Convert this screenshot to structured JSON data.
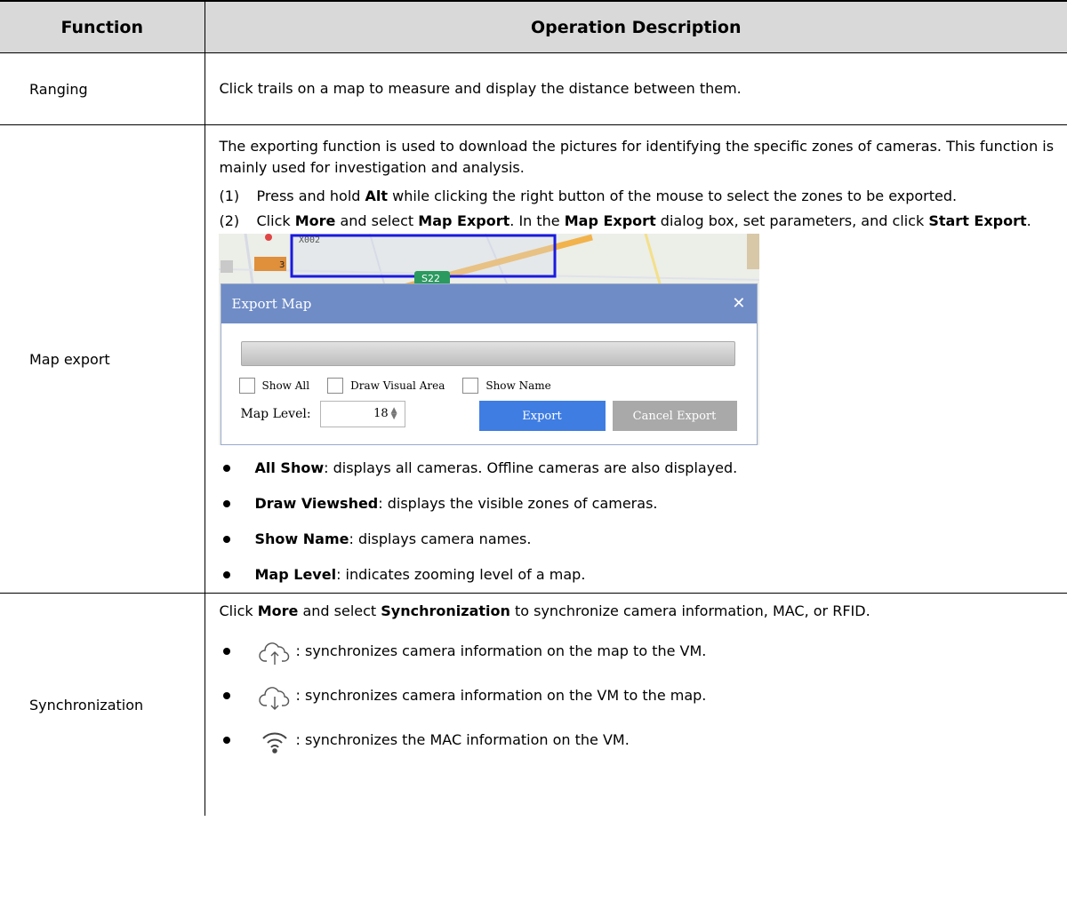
{
  "headers": {
    "function": "Function",
    "description": "Operation Description"
  },
  "rows": {
    "ranging": {
      "function": "Ranging",
      "description": "Click trails on a map to measure and display the distance between them."
    },
    "map_export": {
      "function": "Map export",
      "intro": "The exporting function is used to download the pictures for identifying the specific zones of cameras. This function is mainly used for investigation and analysis.",
      "step1": {
        "num": "(1)",
        "t1": "Press and hold ",
        "b1": "Alt",
        "t2": " while clicking the right button of the mouse to select the zones to be exported."
      },
      "step2": {
        "num": "(2)",
        "t1": "Click ",
        "b1": "More",
        "t2": " and select ",
        "b2": "Map Export",
        "t3": ". In the ",
        "b3": "Map Export",
        "t4": " dialog box, set parameters, and click ",
        "b4": "Start Export",
        "t5": "."
      },
      "screenshot": {
        "map_labels": {
          "road_code": "X002",
          "route_badge": "S22",
          "poi_number": "3"
        },
        "dialog_title": "Export Map",
        "show_all": "Show All",
        "draw_visual_area": "Draw Visual Area",
        "show_name": "Show Name",
        "map_level_label": "Map Level:",
        "map_level_value": "18",
        "export_button": "Export",
        "cancel_export_button": "Cancel Export",
        "colors": {
          "dialog_header": "#6f8cc7",
          "export_button": "#3f7de2",
          "cancel_button": "#a9a9a9",
          "selection_box": "#1a1ae0"
        }
      },
      "bullets": [
        {
          "term": "All Show",
          "text": ": displays all cameras. Offline cameras are also displayed."
        },
        {
          "term": "Draw Viewshed",
          "text": ": displays the visible zones of cameras."
        },
        {
          "term": "Show Name",
          "text": ": displays camera names."
        },
        {
          "term": "Map Level",
          "text": ": indicates zooming level of a map."
        }
      ]
    },
    "synchronization": {
      "function": "Synchronization",
      "intro": {
        "t1": "Click ",
        "b1": "More",
        "t2": " and select ",
        "b2": "Synchronization",
        "t3": " to synchronize camera information, MAC, or RFID."
      },
      "bullets": [
        {
          "icon": "cloud-upload-icon",
          "text": ": synchronizes camera information on the map to the VM."
        },
        {
          "icon": "cloud-download-icon",
          "text": ": synchronizes camera information on the VM to the map."
        },
        {
          "icon": "wifi-icon",
          "text": ": synchronizes the MAC information on the VM."
        }
      ]
    }
  }
}
